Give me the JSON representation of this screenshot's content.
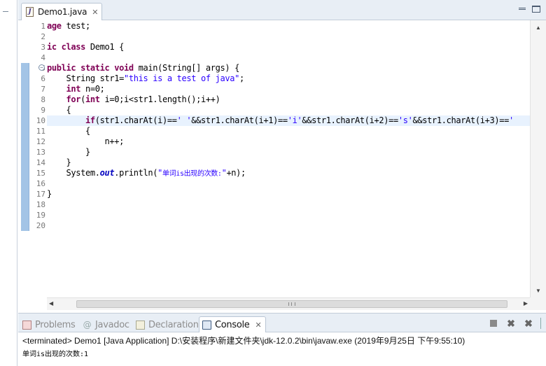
{
  "editor": {
    "tab_title": "Demo1.java",
    "tab_close": "✕",
    "line_numbers": [
      "1",
      "2",
      "3",
      "4",
      "5",
      "6",
      "7",
      "8",
      "9",
      "10",
      "11",
      "12",
      "13",
      "14",
      "15",
      "16",
      "17",
      "18",
      "19",
      "20"
    ],
    "fold_marker": "−",
    "code": {
      "l1_kw": "age",
      "l1_rest": " test;",
      "l3_kw": "ic class",
      "l3_rest": " Demo1 {",
      "l5_kw": "public static void",
      "l5_rest": " main(String[] args) {",
      "l6_pre": "    String str1=",
      "l6_str": "\"this is a test of java\"",
      "l6_post": ";",
      "l7_kw": "    int",
      "l7_rest": " n=0;",
      "l8_kw1": "    for",
      "l8_mid": "(",
      "l8_kw2": "int",
      "l8_rest": " i=0;i<str1.length();i++)",
      "l9": "    {",
      "l10_kw": "        if",
      "l10_a": "(str1.charAt(i)==",
      "l10_s1": "' '",
      "l10_b": "&&str1.charAt(i+1)==",
      "l10_s2": "'i'",
      "l10_c": "&&str1.charAt(i+2)==",
      "l10_s3": "'s'",
      "l10_d": "&&str1.charAt(i+3)==",
      "l10_s4": "'",
      "l11": "        {",
      "l12": "            n++;",
      "l13": "        }",
      "l14": "    }",
      "l15_pre": "    System.",
      "l15_fld": "out",
      "l15_mid": ".println(",
      "l15_str1": "\"",
      "l15_str_cn": "单词is出现的次数:",
      "l15_str2": "\"",
      "l15_post": "+n);",
      "l17": "}"
    }
  },
  "panel": {
    "tabs": [
      {
        "label": "Problems"
      },
      {
        "label": "Javadoc"
      },
      {
        "label": "Declaration"
      },
      {
        "label": "Console"
      }
    ],
    "close": "✕",
    "console_status": "<terminated> Demo1 [Java Application] D:\\安装程序\\新建文件夹\\jdk-12.0.2\\bin\\javaw.exe (2019年9月25日 下午9:55:10)",
    "console_output": "单词is出现的次数:1"
  },
  "colors": {
    "keyword": "#7f0055",
    "string": "#2a00ff",
    "field": "#0000c0",
    "current_line": "#e8f2fe"
  },
  "icons": [
    "java-file-icon",
    "problems-icon",
    "javadoc-icon",
    "declaration-icon",
    "console-icon",
    "terminate-icon",
    "remove-launch-icon",
    "remove-all-terminated-icon"
  ]
}
